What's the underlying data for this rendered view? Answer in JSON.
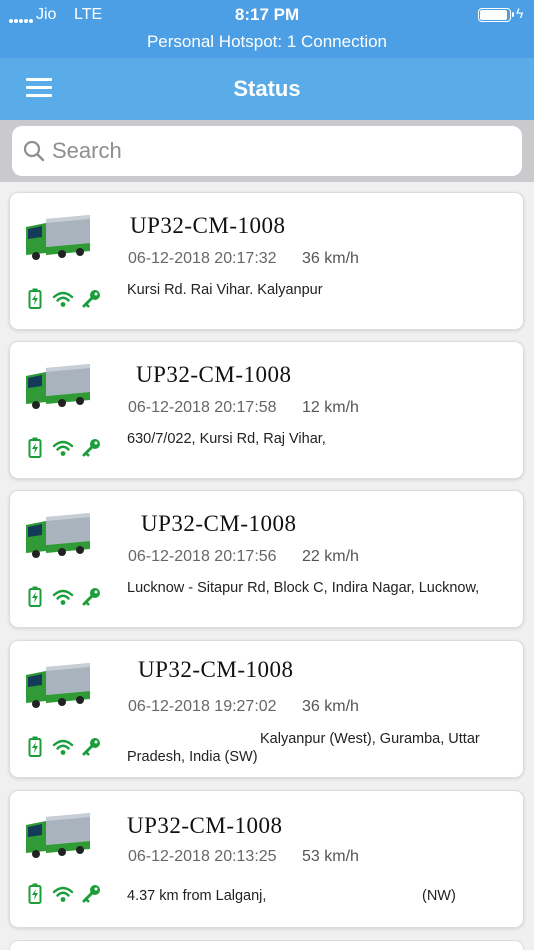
{
  "status_bar": {
    "carrier": "Jio",
    "network": "LTE",
    "time": "8:17 PM",
    "hotspot": "Personal Hotspot: 1 Connection"
  },
  "header": {
    "title": "Status"
  },
  "search": {
    "placeholder": "Search",
    "value": ""
  },
  "vehicles": [
    {
      "plate": "UP32-CM-1008",
      "datetime": "06-12-2018 20:17:32",
      "speed": "36 km/h",
      "address": "Kursi Rd. Rai Vihar. Kalyanpur"
    },
    {
      "plate": "UP32-CM-1008",
      "datetime": "06-12-2018 20:17:58",
      "speed": "12 km/h",
      "address": "630/7/022, Kursi Rd, Raj Vihar,"
    },
    {
      "plate": "UP32-CM-1008",
      "datetime": "06-12-2018 20:17:56",
      "speed": "22 km/h",
      "address": "Lucknow - Sitapur Rd, Block C, Indira Nagar, Lucknow,"
    },
    {
      "plate": "UP32-CM-1008",
      "datetime": "06-12-2018 19:27:02",
      "speed": "36 km/h",
      "address_line1": "Kalyanpur (West), Guramba, Uttar",
      "address_line2": "Pradesh,  India (SW)"
    },
    {
      "plate": "UP32-CM-1008",
      "datetime": "06-12-2018 20:13:25",
      "speed": "53 km/h",
      "address": "4.37 km from Lalganj,",
      "direction": "(NW)"
    }
  ],
  "colors": {
    "header": "#5aace8",
    "status_bar": "#4d9fe5",
    "icon_green": "#1a9e3a"
  },
  "icons": [
    "battery-icon",
    "signal-icon",
    "ignition-key-icon",
    "truck-icon",
    "search-icon",
    "menu-icon"
  ]
}
